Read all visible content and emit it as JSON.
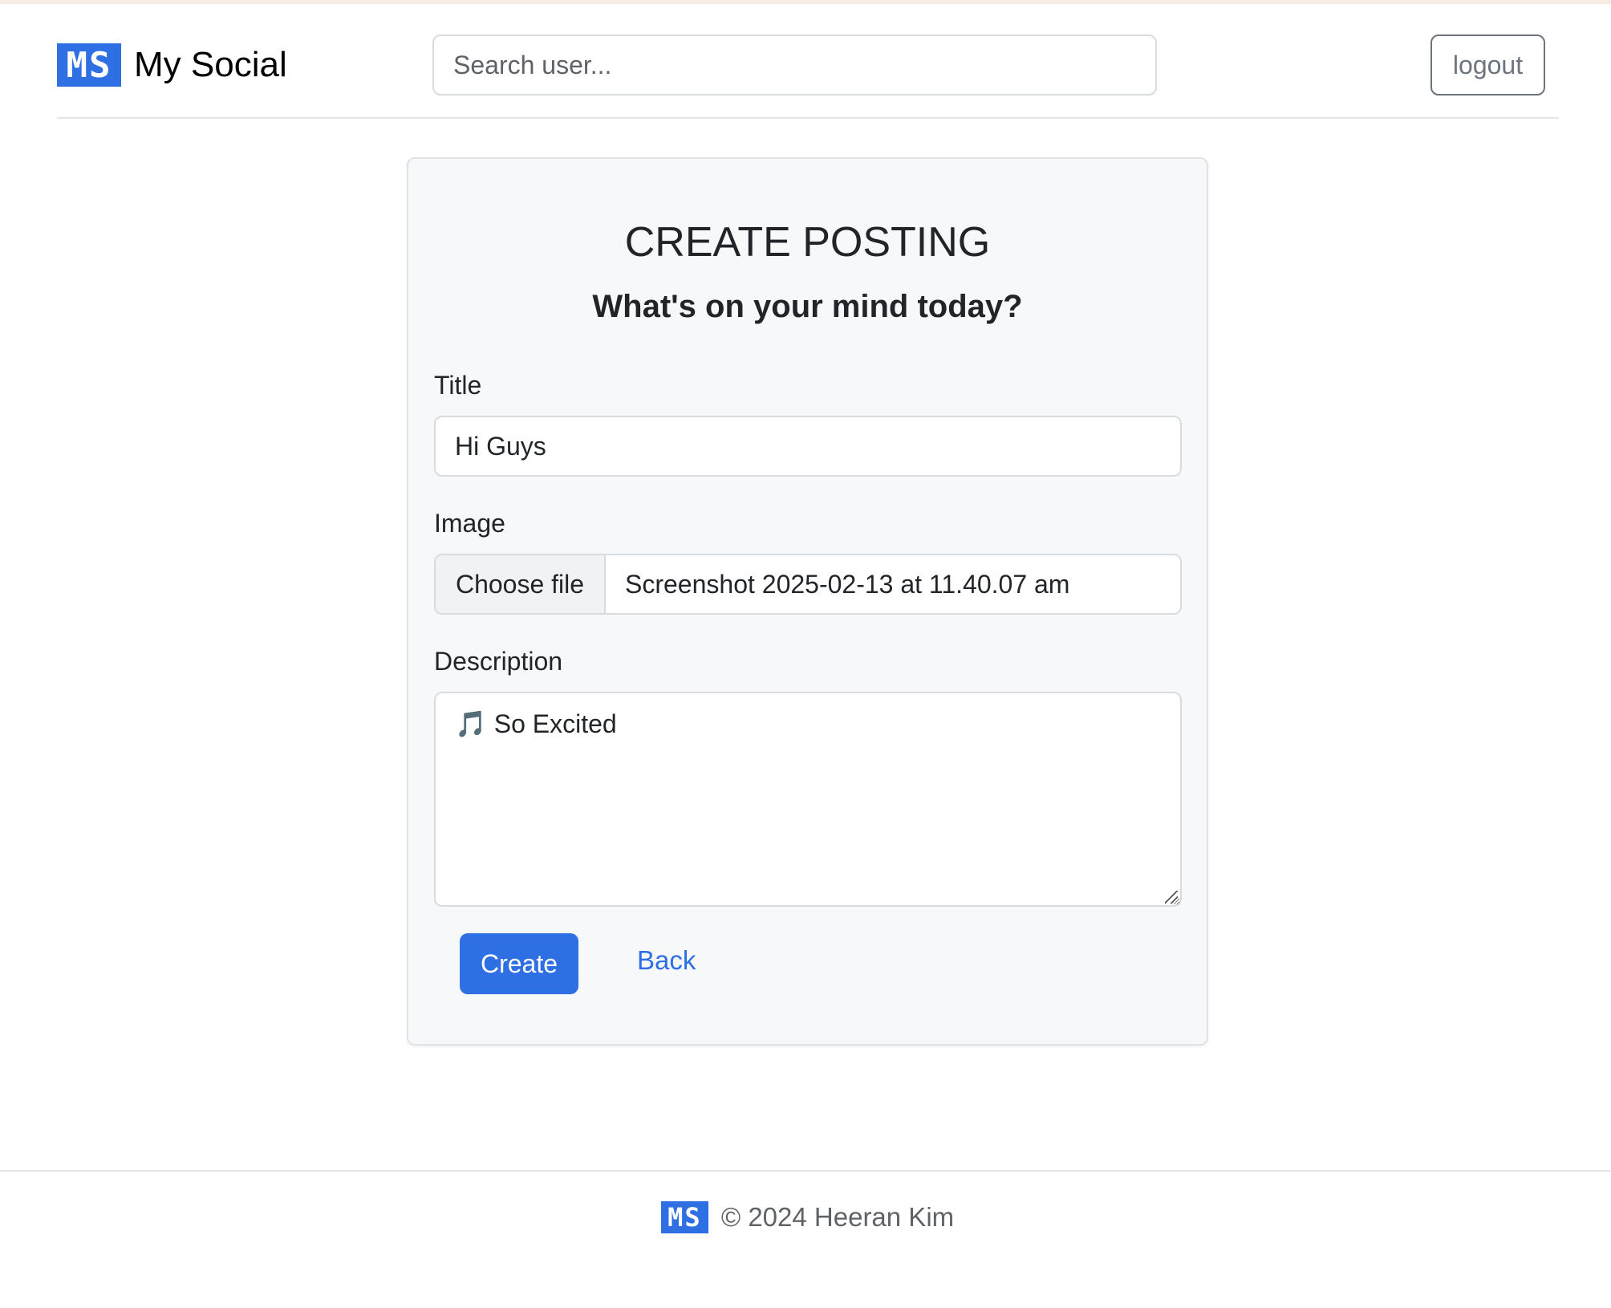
{
  "header": {
    "logo_text": "MS",
    "brand_name": "My Social",
    "search_placeholder": "Search user...",
    "logout_label": "logout"
  },
  "form": {
    "heading": "CREATE POSTING",
    "subheading": "What's on your mind today?",
    "title_label": "Title",
    "title_value": "Hi Guys",
    "image_label": "Image",
    "choose_file_label": "Choose file",
    "file_name": "Screenshot 2025-02-13 at 11.40.07 am",
    "description_label": "Description",
    "description_value": "🎵 So Excited",
    "create_label": "Create",
    "back_label": "Back"
  },
  "footer": {
    "logo_text": "MS",
    "copyright": "© 2024 Heeran Kim"
  },
  "colors": {
    "accent": "#2f6fe4",
    "card_background": "#f7f8fa",
    "muted_text": "#5f6368"
  }
}
